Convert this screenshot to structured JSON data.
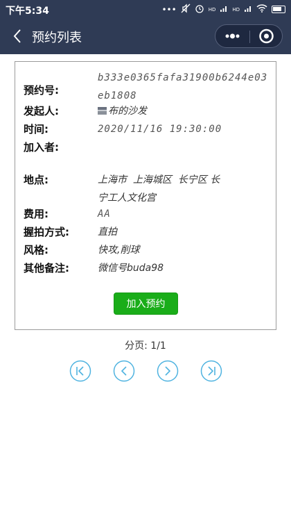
{
  "status_bar": {
    "time": "下午5:34",
    "signal1": "HD",
    "signal2": "HD"
  },
  "nav": {
    "title": "预约列表"
  },
  "card": {
    "fields": [
      {
        "label": "预约号:",
        "value": "b333e0365fafa31900b6244e03eb1808"
      },
      {
        "label": "发起人:",
        "value": "布的沙发"
      },
      {
        "label": "时间:",
        "value": "2020/11/16 19:30:00"
      },
      {
        "label": "加入者:",
        "value": ""
      },
      {
        "label": "地点:",
        "value": "上海市  上海城区  长宁区 长宁工人文化宫"
      },
      {
        "label": "费用:",
        "value": "AA"
      },
      {
        "label": "握拍方式:",
        "value": "直拍"
      },
      {
        "label": "风格:",
        "value": "快攻,削球"
      },
      {
        "label": "其他备注:",
        "value": "微信号buda98"
      }
    ],
    "join_button": "加入预约"
  },
  "pagination": {
    "info": "分页: 1/1"
  },
  "colors": {
    "header_bg": "#2f3b55",
    "button_green": "#1aad19",
    "pager_blue": "#4fb3e0"
  }
}
